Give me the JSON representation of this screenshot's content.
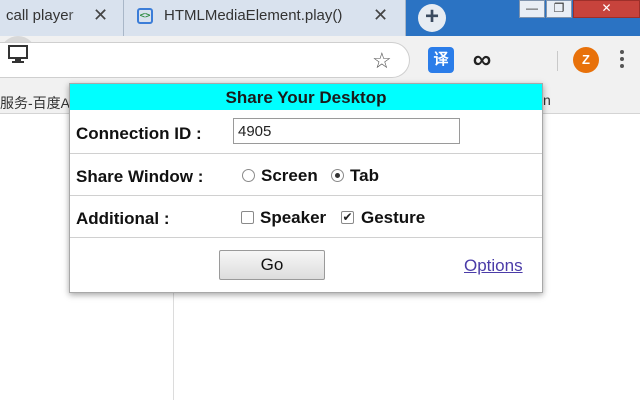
{
  "browser": {
    "tabs": [
      {
        "title": "call player"
      },
      {
        "title": "HTMLMediaElement.play()"
      }
    ],
    "newtab_glyph": "+",
    "window_buttons": {
      "minimize": "—",
      "maximize": "❐",
      "close": "✕"
    },
    "bookmark_text": "服务-百度A",
    "bookmark_right": "n",
    "profile_initial": "Z",
    "icons": {
      "star": "star-icon",
      "translate": "translate-icon",
      "infinity": "infinity-icon",
      "desktop": "desktop-share-icon",
      "menu": "kebab-menu-icon"
    },
    "translate_glyph": "译",
    "infinity_glyph": "∞"
  },
  "popup": {
    "title": "Share Your Desktop",
    "connection": {
      "label": "Connection ID :",
      "value": "4905"
    },
    "share_window": {
      "label": "Share Window :",
      "options": [
        {
          "label": "Screen",
          "checked": false
        },
        {
          "label": "Tab",
          "checked": true
        }
      ]
    },
    "additional": {
      "label": "Additional :",
      "options": [
        {
          "label": "Speaker",
          "checked": false
        },
        {
          "label": "Gesture",
          "checked": true
        }
      ]
    },
    "go_label": "Go",
    "options_link": "Options",
    "title_bg": "#00ffff"
  }
}
